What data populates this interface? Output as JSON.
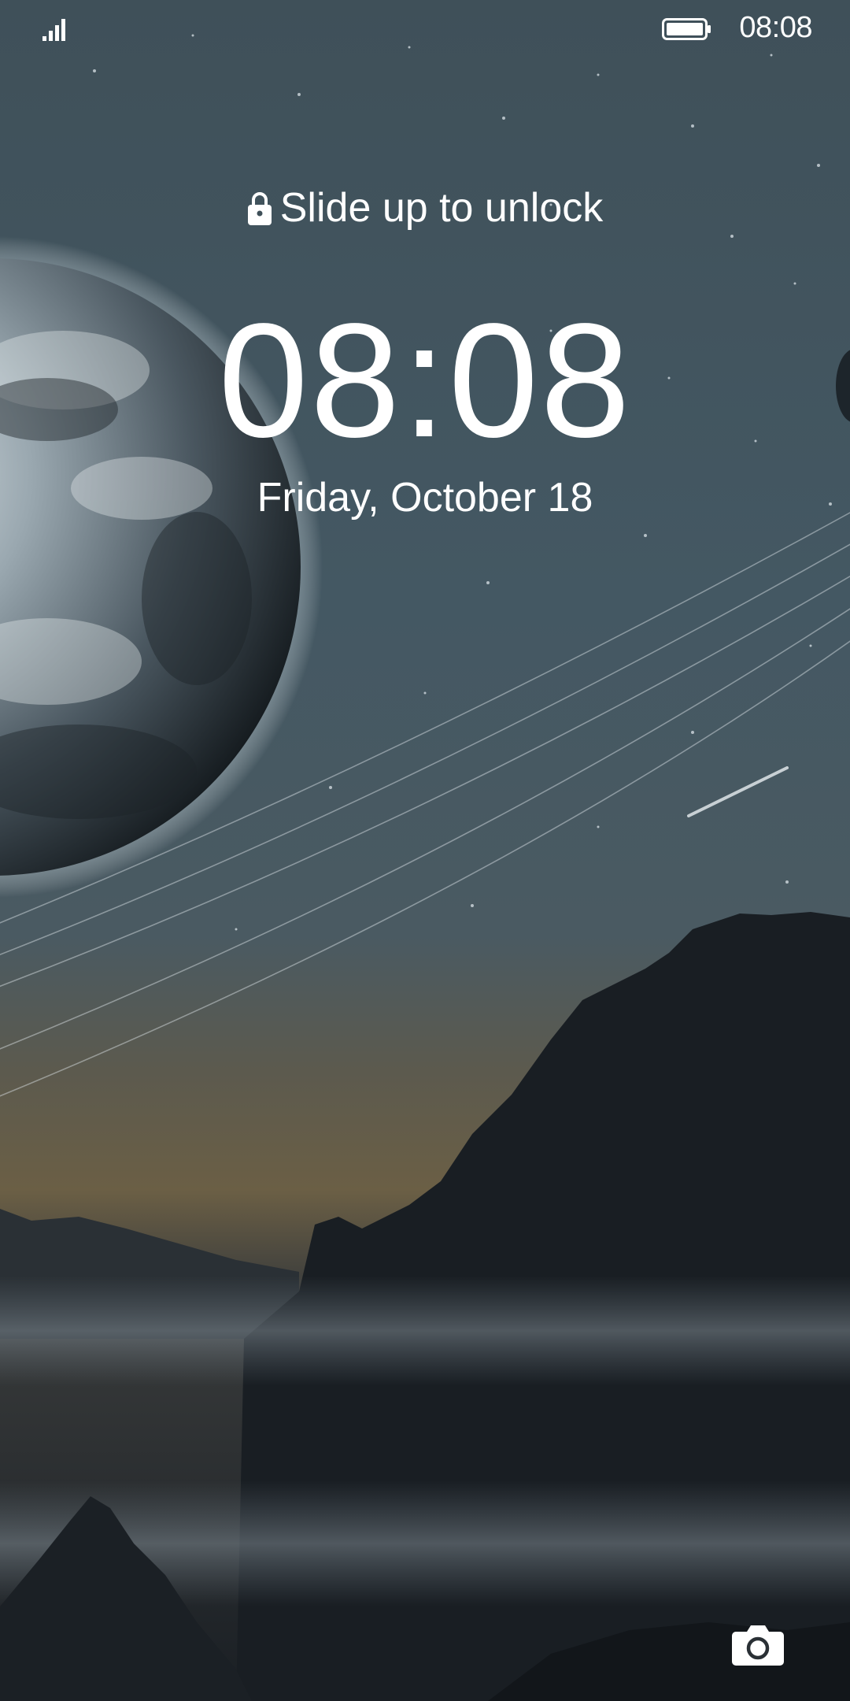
{
  "status_bar": {
    "signal_icon": "signal-bars-icon",
    "battery_icon": "battery-icon",
    "time": "08:08"
  },
  "lockscreen": {
    "lock_icon": "lock-icon",
    "unlock_hint": "Slide up to unlock",
    "clock": "08:08",
    "date": "Friday, October 18",
    "camera_icon": "camera-icon"
  },
  "colors": {
    "text": "#ffffff",
    "sky": "#3d4e58",
    "mountains": "#15191e"
  }
}
